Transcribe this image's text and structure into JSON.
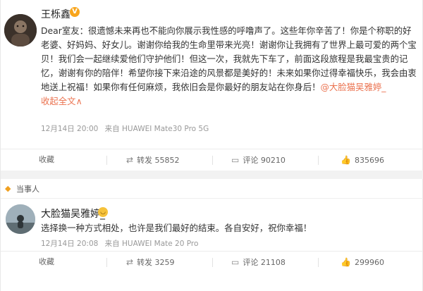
{
  "post1": {
    "author": "王栎鑫",
    "badge": "V",
    "content": "Dear室友：很遗憾未来再也不能向你展示我性感的呼噜声了。这些年你辛苦了！你是个称职的好老婆、好妈妈、好女儿。谢谢你给我的生命里带来光亮！谢谢你让我拥有了世界上最可爱的两个宝贝！我们会一起继续爱他们守护他们！但这一次，我就先下车了，前面这段旅程是我最宝贵的记忆，谢谢有你的陪伴！希望你接下来沿途的风景都是美好的！未来如果你过得幸福快乐，我会由衷地送上祝福！如果你有任何麻烦，我依旧会是你最好的朋友站在你身后！",
    "mention": "@大脸猫吴雅婷_",
    "collapse": "收起全文",
    "collapse_icon": "∧",
    "date": "12月14日 20:00",
    "source": "来自 HUAWEI Mate30 Pro 5G",
    "actions": {
      "favorite": "收藏",
      "repost": "转发 55852",
      "comment": "评论 90210",
      "like": "835696"
    }
  },
  "tag": {
    "label": "当事人"
  },
  "post2": {
    "author": "大脸猫吴雅婷_",
    "content": "选择换一种方式相处，也许是我们最好的结束。各自安好，祝你幸福！",
    "date": "12月14日 20:08",
    "source": "来自 HUAWEI Mate 20 Pro",
    "actions": {
      "favorite": "收藏",
      "repost": "转发 3259",
      "comment": "评论 21108",
      "like": "299960"
    }
  },
  "colors": {
    "accent": "#eb7350",
    "badge": "#f8a51c",
    "text": "#333333",
    "meta": "#999999"
  }
}
